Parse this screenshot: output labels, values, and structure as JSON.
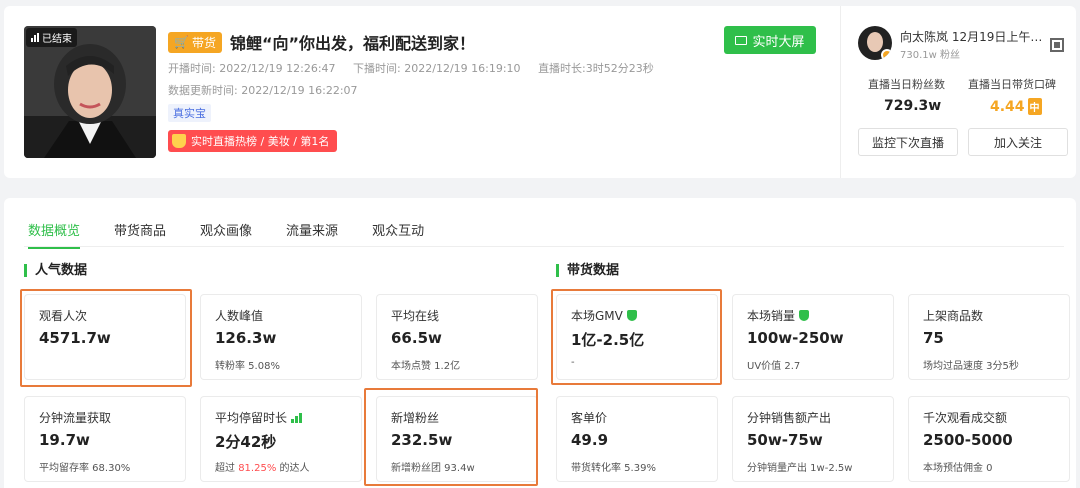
{
  "live": {
    "ended_label": "已结束",
    "goods_tag": "带货",
    "title": "锦鲤“向”你出发，福利配送到家！",
    "start_label": "开播时间:",
    "start_time": "2022/12/19 12:26:47",
    "end_label": "下播时间:",
    "end_time": "2022/12/19 16:19:10",
    "duration_label": "直播时长:",
    "duration": "3时52分23秒",
    "update_label": "数据更新时间:",
    "update_time": "2022/12/19 16:22:07",
    "auth_tag": "真实宝",
    "hot_rank": "实时直播热榜 / 美妆 / 第1名",
    "realtime_button": "实时大屏"
  },
  "anchor": {
    "name": "向太陈岚 12月19日上午11...",
    "fans": "730.1w 粉丝",
    "stats": [
      {
        "label": "直播当日粉丝数",
        "value": "729.3w"
      },
      {
        "label": "直播当日带货口碑",
        "value": "4.44",
        "badge": "中"
      }
    ],
    "monitor_button": "监控下次直播",
    "follow_button": "加入关注"
  },
  "tabs": [
    "数据概览",
    "带货商品",
    "观众画像",
    "流量来源",
    "观众互动"
  ],
  "popularity": {
    "title": "人气数据",
    "cards": [
      {
        "label": "观看人次",
        "value": "4571.7w",
        "sub": ""
      },
      {
        "label": "人数峰值",
        "value": "126.3w",
        "sub": "转粉率 5.08%"
      },
      {
        "label": "平均在线",
        "value": "66.5w",
        "sub": "本场点赞 1.2亿"
      },
      {
        "label": "分钟流量获取",
        "value": "19.7w",
        "sub": "平均留存率 68.30%"
      },
      {
        "label": "平均停留时长",
        "value": "2分42秒",
        "sub_prefix": "超过 ",
        "sub_highlight": "81.25%",
        "sub_suffix": " 的达人"
      },
      {
        "label": "新增粉丝",
        "value": "232.5w",
        "sub": "新增粉丝团 93.4w"
      }
    ]
  },
  "sales": {
    "title": "带货数据",
    "cards": [
      {
        "label": "本场GMV",
        "value": "1亿-2.5亿",
        "sub": "-"
      },
      {
        "label": "本场销量",
        "value": "100w-250w",
        "sub": "UV价值 2.7"
      },
      {
        "label": "上架商品数",
        "value": "75",
        "sub": "场均过品速度 3分5秒"
      },
      {
        "label": "客单价",
        "value": "49.9",
        "sub": "带货转化率 5.39%"
      },
      {
        "label": "分钟销售额产出",
        "value": "50w-75w",
        "sub": "分钟销量产出 1w-2.5w"
      },
      {
        "label": "千次观看成交额",
        "value": "2500-5000",
        "sub": "本场预估佣金 0"
      }
    ]
  },
  "colors": {
    "accent": "#2fbf4a",
    "highlight_border": "#e87a3a",
    "orange": "#f5a623",
    "red": "#ff4d4f"
  }
}
